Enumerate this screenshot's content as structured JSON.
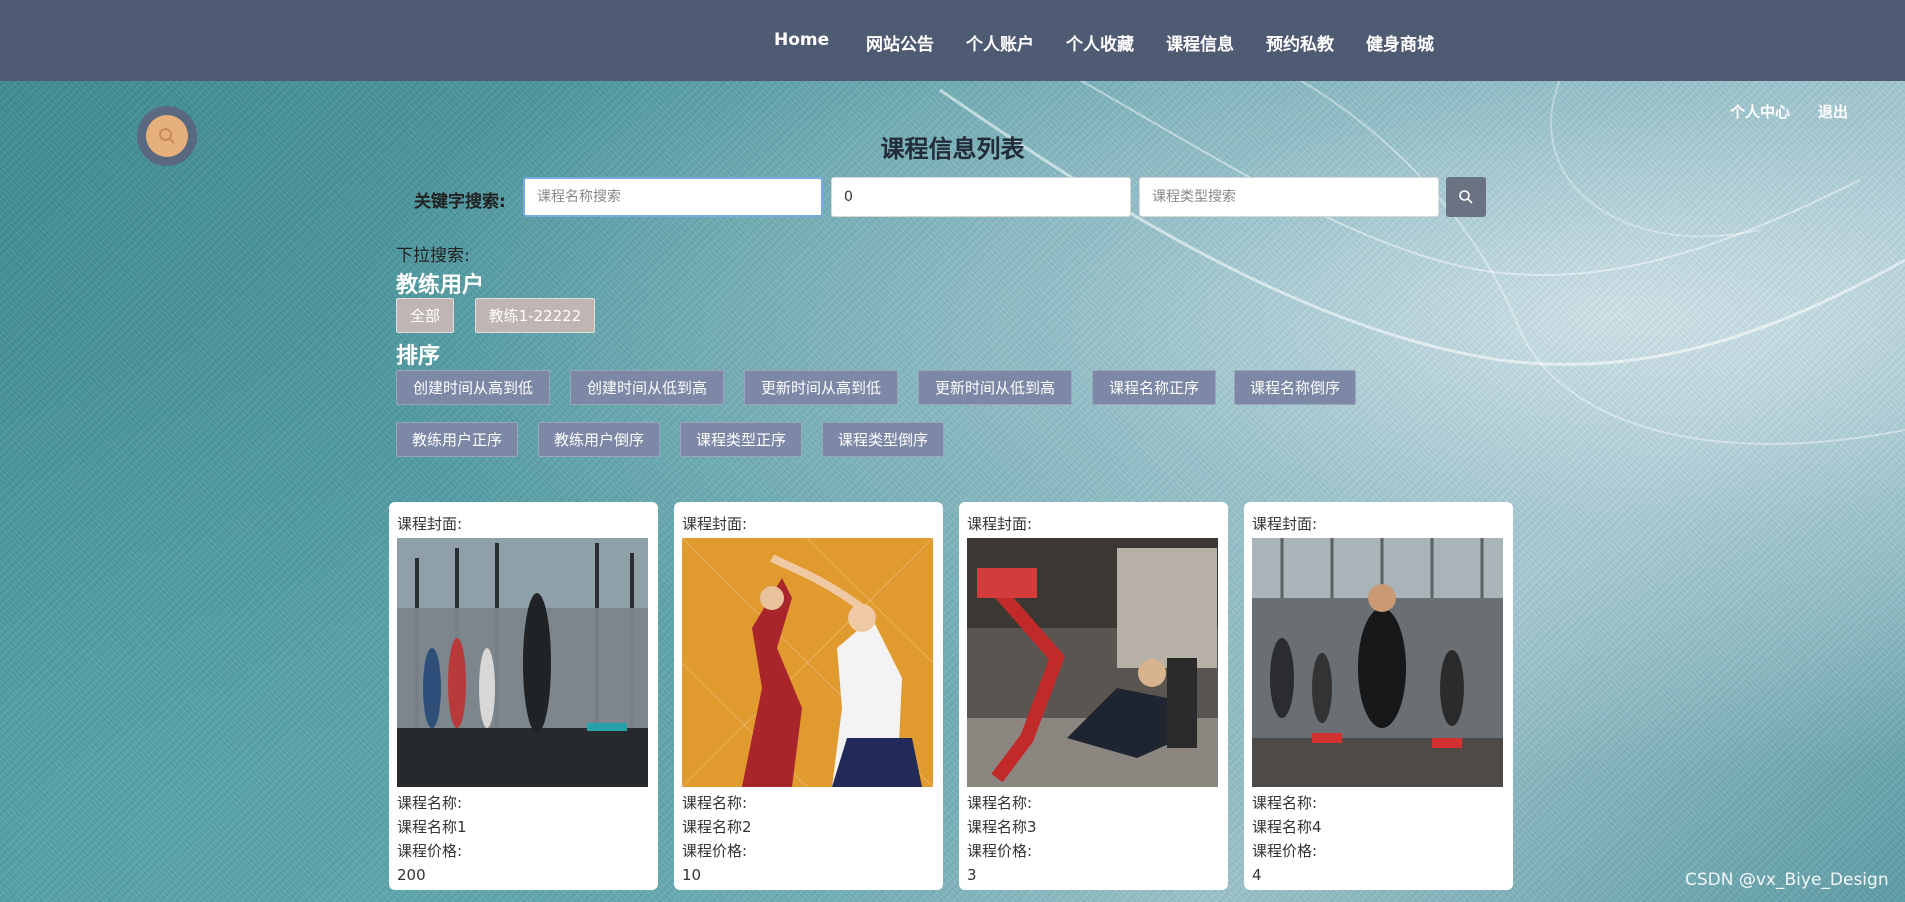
{
  "nav": {
    "items": [
      "Home",
      "网站公告",
      "个人账户",
      "个人收藏",
      "课程信息",
      "预约私教",
      "健身商城"
    ]
  },
  "top_links": {
    "center": "个人中心",
    "logout": "退出"
  },
  "page_title": "课程信息列表",
  "search": {
    "label": "关键字搜索:",
    "name_placeholder": "课程名称搜索",
    "middle_value": "0",
    "type_placeholder": "课程类型搜索"
  },
  "dropdown_label": "下拉搜索:",
  "coach_section": {
    "title": "教练用户",
    "options": [
      "全部",
      "教练1-22222"
    ]
  },
  "sort_section": {
    "title": "排序",
    "options": [
      "创建时间从高到低",
      "创建时间从低到高",
      "更新时间从高到低",
      "更新时间从低到高",
      "课程名称正序",
      "课程名称倒序",
      "教练用户正序",
      "教练用户倒序",
      "课程类型正序",
      "课程类型倒序"
    ]
  },
  "cards": [
    {
      "cover_label": "课程封面:",
      "name_label": "课程名称:",
      "name": "课程名称1",
      "price_label": "课程价格:",
      "price": "200"
    },
    {
      "cover_label": "课程封面:",
      "name_label": "课程名称:",
      "name": "课程名称2",
      "price_label": "课程价格:",
      "price": "10"
    },
    {
      "cover_label": "课程封面:",
      "name_label": "课程名称:",
      "name": "课程名称3",
      "price_label": "课程价格:",
      "price": "3"
    },
    {
      "cover_label": "课程封面:",
      "name_label": "课程名称:",
      "name": "课程名称4",
      "price_label": "课程价格:",
      "price": "4"
    }
  ],
  "watermark": "CSDN @vx_Biye_Design",
  "colors": {
    "nav_bg": "#4f5b73",
    "sort_button": "#7c88a6",
    "search_button": "#6b7383"
  }
}
